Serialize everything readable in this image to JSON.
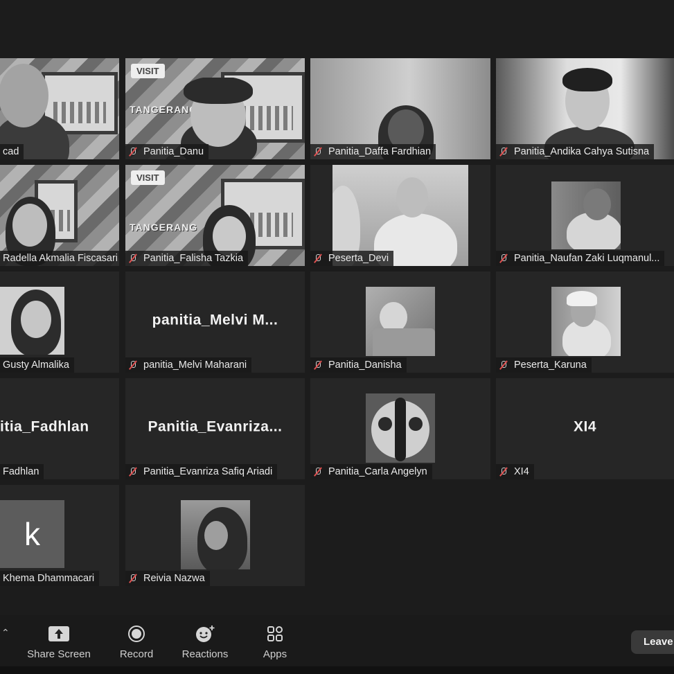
{
  "participants": [
    {
      "display": "cad",
      "big": "",
      "kind": "banner"
    },
    {
      "display": "Panitia_Danu",
      "big": "",
      "kind": "banner",
      "muted": true
    },
    {
      "display": "Panitia_Daffa Fardhian",
      "big": "",
      "kind": "video",
      "muted": true
    },
    {
      "display": "Panitia_Andika Cahya Sutisna",
      "big": "",
      "kind": "video",
      "muted": true
    },
    {
      "display": "Radella Akmalia Fiscasari",
      "big": "",
      "kind": "banner"
    },
    {
      "display": "Panitia_Falisha Tazkia",
      "big": "",
      "kind": "banner",
      "muted": true
    },
    {
      "display": "Peserta_Devi",
      "big": "",
      "kind": "video",
      "muted": true
    },
    {
      "display": "Panitia_Naufan Zaki Luqmanul...",
      "big": "",
      "kind": "small-video",
      "muted": true
    },
    {
      "display": "Gusty Almalika",
      "big": "",
      "kind": "small-video"
    },
    {
      "display": "panitia_Melvi Maharani",
      "big": "panitia_Melvi  M...",
      "kind": "name",
      "muted": true
    },
    {
      "display": "Panitia_Danisha",
      "big": "",
      "kind": "small-video",
      "muted": true
    },
    {
      "display": "Peserta_Karuna",
      "big": "",
      "kind": "small-video",
      "muted": true
    },
    {
      "display": "Fadhlan",
      "big": "itia_Fadhlan",
      "kind": "name"
    },
    {
      "display": "Panitia_Evanriza Safiq Ariadi",
      "big": "Panitia_Evanriza...",
      "kind": "name",
      "muted": true
    },
    {
      "display": "Panitia_Carla Angelyn",
      "big": "",
      "kind": "small-video",
      "muted": true
    },
    {
      "display": "XI4",
      "big": "XI4",
      "kind": "name",
      "muted": true
    },
    {
      "display": "Khema Dhammacari",
      "big": "k",
      "kind": "avatar"
    },
    {
      "display": "Reivia Nazwa",
      "big": "",
      "kind": "small-video",
      "muted": true
    }
  ],
  "banner": {
    "visit": "VISIT",
    "city": "TANGERANG"
  },
  "toolbar": {
    "share_screen": "Share Screen",
    "record": "Record",
    "reactions": "Reactions",
    "apps": "Apps",
    "leave": "Leave"
  },
  "colors": {
    "background": "#1c1c1c",
    "tile": "#262626",
    "label_bg": "#191919"
  }
}
